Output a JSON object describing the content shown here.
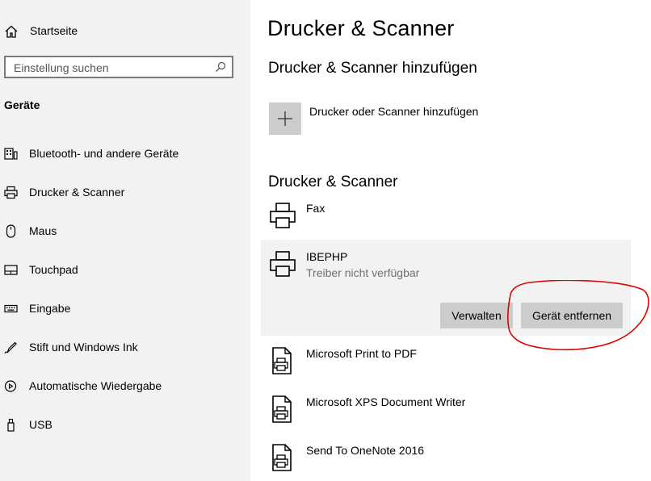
{
  "sidebar": {
    "home_label": "Startseite",
    "search_placeholder": "Einstellung suchen",
    "section_title": "Geräte",
    "items": [
      {
        "label": "Bluetooth- und andere Geräte",
        "icon": "bluetooth-devices-icon"
      },
      {
        "label": "Drucker & Scanner",
        "icon": "printer-icon"
      },
      {
        "label": "Maus",
        "icon": "mouse-icon"
      },
      {
        "label": "Touchpad",
        "icon": "touchpad-icon"
      },
      {
        "label": "Eingabe",
        "icon": "keyboard-icon"
      },
      {
        "label": "Stift und Windows Ink",
        "icon": "pen-icon"
      },
      {
        "label": "Automatische Wiedergabe",
        "icon": "autoplay-icon"
      },
      {
        "label": "USB",
        "icon": "usb-icon"
      }
    ]
  },
  "main": {
    "title": "Drucker & Scanner",
    "add_section_title": "Drucker & Scanner hinzufügen",
    "add_button_label": "Drucker oder Scanner hinzufügen",
    "list_section_title": "Drucker & Scanner",
    "devices": [
      {
        "name": "Fax",
        "status": "",
        "icon": "printer-icon"
      },
      {
        "name": "IBEPHP",
        "status": "Treiber nicht verfügbar",
        "icon": "printer-icon",
        "selected": true
      },
      {
        "name": "Microsoft Print to PDF",
        "status": "",
        "icon": "document-printer-icon"
      },
      {
        "name": "Microsoft XPS Document Writer",
        "status": "",
        "icon": "document-printer-icon"
      },
      {
        "name": "Send To OneNote 2016",
        "status": "",
        "icon": "document-printer-icon"
      }
    ],
    "buttons": {
      "manage": "Verwalten",
      "remove": "Gerät entfernen"
    }
  },
  "colors": {
    "sidebar_bg": "#f2f2f2",
    "button_bg": "#cccccc",
    "selected_bg": "#f2f2f2",
    "status_text": "#707070",
    "annotation": "#e00000"
  }
}
